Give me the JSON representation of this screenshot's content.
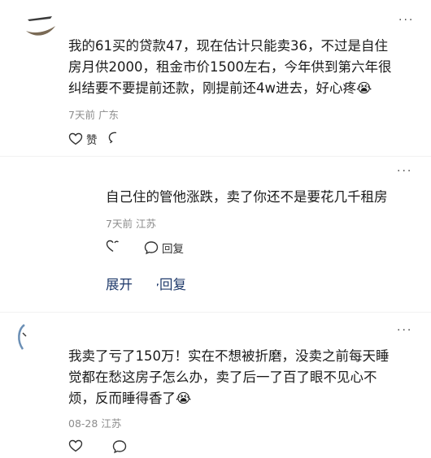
{
  "comments": [
    {
      "text": "我的61买的贷款47，现在估计只能卖36，不过是自住\n房月供2000，租金市价1500左右，今年供到第六年很\n纠结要不要提前还款，刚提前还4w进去，好心疼😭",
      "time": "7天前",
      "location": "广东",
      "like_label": "赞"
    },
    {
      "text": "自己住的管他涨跌，卖了你还不是要花几千租房",
      "time": "7天前",
      "location": "江苏",
      "reply_label": "回复",
      "expand_label": "展开更多回复"
    },
    {
      "text": "我卖了亏了150万！实在不想被折磨，没卖之前每天睡\n觉都在愁这房子怎么办，卖了后一了百了眼不见心不\n烦，反而睡得香了😭",
      "time": "08-28",
      "location": "江苏"
    }
  ],
  "icons": {
    "more": "more-dots-icon",
    "like": "heart-icon",
    "reply": "comment-bubble-icon"
  },
  "colors": {
    "text": "#1a1a1a",
    "meta": "#8c8c8c",
    "link": "#1f3a6b"
  }
}
